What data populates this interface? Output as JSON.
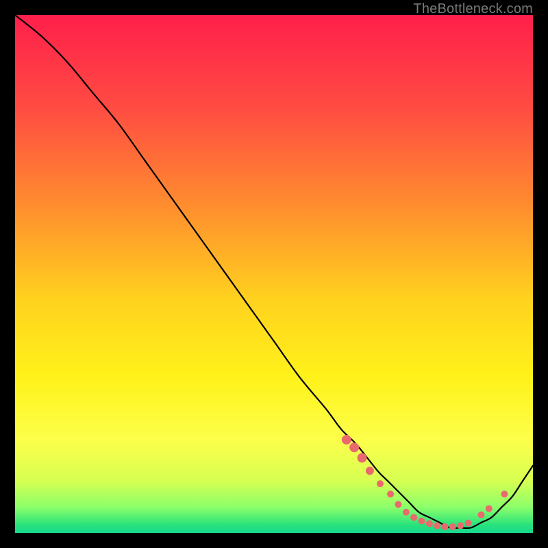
{
  "watermark": "TheBottleneck.com",
  "chart_data": {
    "type": "line",
    "xlim": [
      0,
      100
    ],
    "ylim": [
      0,
      100
    ],
    "grid": false,
    "legend": false,
    "title": "",
    "xlabel": "",
    "ylabel": "",
    "background_gradient": {
      "stops": [
        {
          "pos": 0.0,
          "color": "#ff1f4b"
        },
        {
          "pos": 0.18,
          "color": "#ff4c42"
        },
        {
          "pos": 0.36,
          "color": "#ff8a2f"
        },
        {
          "pos": 0.55,
          "color": "#ffd21e"
        },
        {
          "pos": 0.7,
          "color": "#fff21a"
        },
        {
          "pos": 0.82,
          "color": "#fcff4a"
        },
        {
          "pos": 0.9,
          "color": "#d6ff52"
        },
        {
          "pos": 0.95,
          "color": "#8cff6a"
        },
        {
          "pos": 0.985,
          "color": "#28e27c"
        },
        {
          "pos": 1.0,
          "color": "#17d88e"
        }
      ]
    },
    "series": [
      {
        "name": "curve",
        "color": "#000000",
        "x": [
          0,
          5,
          10,
          15,
          20,
          25,
          30,
          35,
          40,
          45,
          50,
          55,
          60,
          63,
          66,
          70,
          72,
          74,
          76,
          78,
          80,
          82,
          84,
          86,
          88,
          90,
          92,
          94,
          96,
          98,
          100
        ],
        "y": [
          100,
          96,
          91,
          85,
          79,
          72,
          65,
          58,
          51,
          44,
          37,
          30,
          24,
          20,
          17,
          12,
          10,
          8,
          6,
          4,
          3,
          2,
          1,
          1,
          1,
          2,
          3,
          5,
          7,
          10,
          13
        ]
      }
    ],
    "markers": {
      "name": "dots",
      "color": "#e96a6d",
      "radius_px": 6,
      "points": [
        {
          "x": 64.0,
          "y": 18.0,
          "r": 7
        },
        {
          "x": 65.5,
          "y": 16.5,
          "r": 7
        },
        {
          "x": 67.0,
          "y": 14.5,
          "r": 7
        },
        {
          "x": 68.5,
          "y": 12.0,
          "r": 6
        },
        {
          "x": 70.5,
          "y": 9.5,
          "r": 5
        },
        {
          "x": 72.5,
          "y": 7.5,
          "r": 5
        },
        {
          "x": 74.0,
          "y": 5.5,
          "r": 5
        },
        {
          "x": 75.5,
          "y": 4.0,
          "r": 5
        },
        {
          "x": 77.0,
          "y": 3.0,
          "r": 5
        },
        {
          "x": 78.5,
          "y": 2.3,
          "r": 5
        },
        {
          "x": 80.0,
          "y": 1.8,
          "r": 5
        },
        {
          "x": 81.5,
          "y": 1.4,
          "r": 5
        },
        {
          "x": 83.0,
          "y": 1.2,
          "r": 5
        },
        {
          "x": 84.5,
          "y": 1.2,
          "r": 5
        },
        {
          "x": 86.0,
          "y": 1.4,
          "r": 5
        },
        {
          "x": 87.5,
          "y": 1.9,
          "r": 5
        },
        {
          "x": 90.0,
          "y": 3.5,
          "r": 5
        },
        {
          "x": 91.5,
          "y": 4.7,
          "r": 5
        },
        {
          "x": 94.5,
          "y": 7.5,
          "r": 5
        }
      ]
    }
  }
}
